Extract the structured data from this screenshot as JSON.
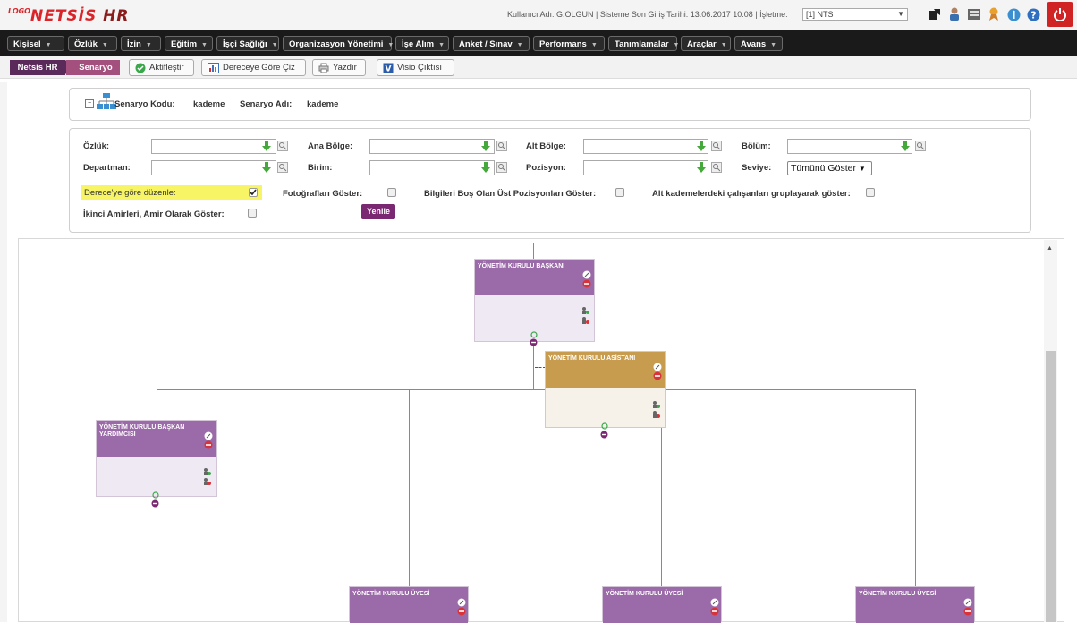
{
  "header": {
    "logo_prefix": "LOGO",
    "logo_main": "NETSİS",
    "logo_suffix": "HR",
    "user_info": "Kullanıcı Adı: G.OLGUN | Sisteme Son Giriş Tarihi: 13.06.2017 10:08 | İşletme:",
    "company_value": "[1] NTS",
    "icons": [
      "external-link-icon",
      "user-icon",
      "list-icon",
      "ribbon-icon",
      "info-icon",
      "help-icon",
      "power-icon"
    ]
  },
  "menu": {
    "items": [
      "Kişisel",
      "Özlük",
      "İzin",
      "Eğitim",
      "İşçi Sağlığı",
      "Organizasyon Yönetimi",
      "İşe Alım",
      "Anket / Sınav",
      "Performans",
      "Tanımlamalar",
      "Araçlar",
      "Avans"
    ]
  },
  "toolbar": {
    "crumb_home": "Netsis HR",
    "crumb_current": "Senaryo",
    "activate_label": "Aktifleştir",
    "draw_by_level_label": "Dereceye Göre Çiz",
    "print_label": "Yazdır",
    "visio_label": "Visio Çıktısı"
  },
  "scenario": {
    "code_label": "Senaryo Kodu:",
    "code_value": "kademe",
    "name_label": "Senaryo Adı:",
    "name_value": "kademe"
  },
  "filters": {
    "ozluk_label": "Özlük:",
    "ana_bolge_label": "Ana Bölge:",
    "alt_bolge_label": "Alt Bölge:",
    "bolum_label": "Bölüm:",
    "departman_label": "Departman:",
    "birim_label": "Birim:",
    "pozisyon_label": "Pozisyon:",
    "seviye_label": "Seviye:",
    "seviye_value": "Tümünü Göster",
    "derece_label": "Derece'ye göre düzenle:",
    "derece_checked": true,
    "foto_label": "Fotoğrafları Göster:",
    "bos_ust_label": "Bilgileri Boş Olan Üst Pozisyonları Göster:",
    "alt_kademe_label": "Alt kademelerdeki çalışanları gruplayarak göster:",
    "ikinci_amir_label": "İkinci Amirleri, Amir Olarak Göster:",
    "refresh_label": "Yenile"
  },
  "chart": {
    "nodes": [
      {
        "title": "YÖNETİM KURULU BAŞKANI",
        "color": "#9b6aa8"
      },
      {
        "title": "YÖNETİM KURULU ASİSTANI",
        "color": "#c79c4e"
      },
      {
        "title": "YÖNETİM KURULU BAŞKAN YARDIMCISI",
        "color": "#9b6aa8"
      },
      {
        "title": "YÖNETİM KURULU ÜYESİ",
        "color": "#9b6aa8"
      },
      {
        "title": "YÖNETİM KURULU ÜYESİ",
        "color": "#9b6aa8"
      },
      {
        "title": "YÖNETİM KURULU ÜYESİ",
        "color": "#9b6aa8"
      }
    ]
  }
}
